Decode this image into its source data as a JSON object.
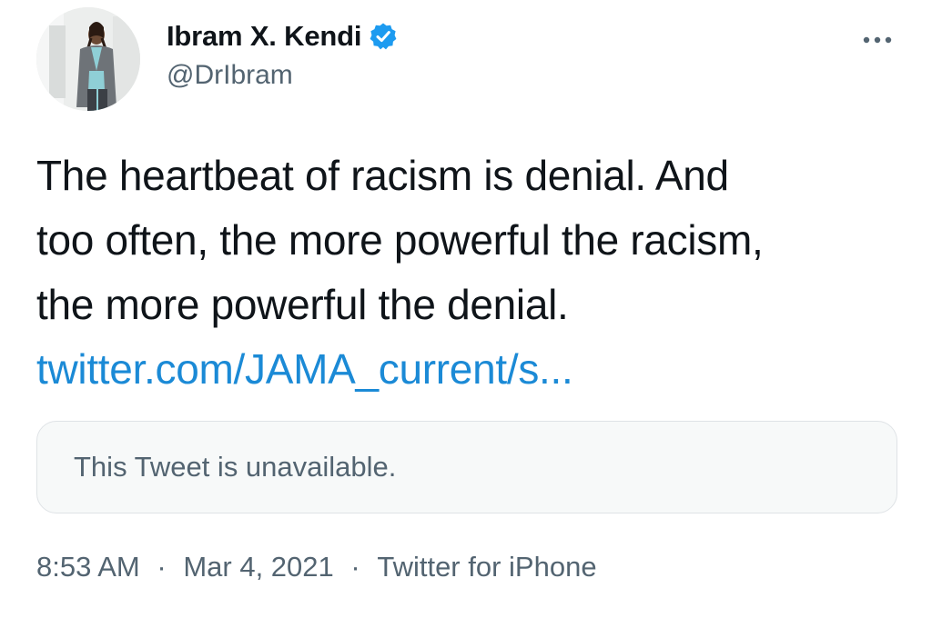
{
  "author": {
    "display_name": "Ibram X. Kendi",
    "handle": "@DrIbram",
    "verified": true
  },
  "tweet": {
    "lines": [
      "The heartbeat of racism is denial. And",
      "too often, the more powerful the racism,",
      "the more powerful the denial."
    ],
    "link": "twitter.com/JAMA_current/s..."
  },
  "quoted_tweet": {
    "message": "This Tweet is unavailable."
  },
  "meta": {
    "time": "8:53 AM",
    "separator": "·",
    "date": "Mar 4, 2021",
    "source": "Twitter for iPhone"
  },
  "icons": {
    "verified": "verified-badge-icon",
    "more": "more-options-icon"
  },
  "colors": {
    "verified_blue": "#1d9bf0",
    "link_blue": "#1b8ad6",
    "secondary_text": "#536471",
    "card_background": "#f7f9f9"
  }
}
